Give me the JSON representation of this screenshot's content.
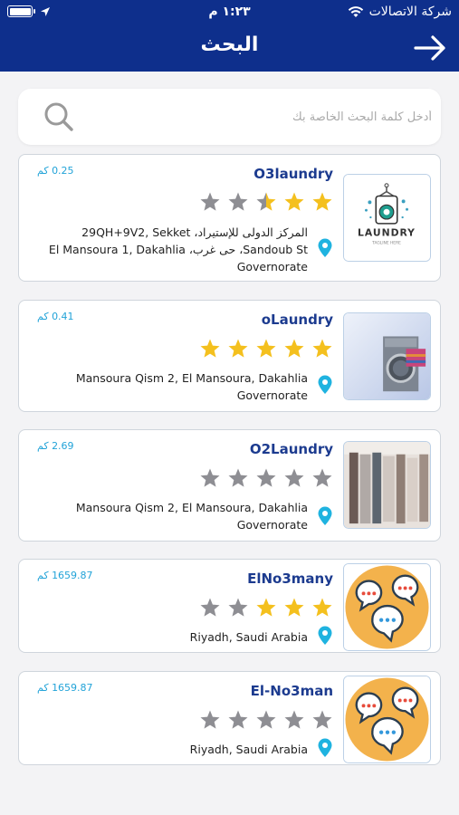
{
  "status_bar": {
    "carrier": "شركة الاتصالات",
    "time": "١:٢٣ م"
  },
  "header": {
    "title": "البحث"
  },
  "search": {
    "placeholder": "أدخل كلمة البحث الخاصة بك",
    "value": ""
  },
  "colors": {
    "header_bg": "#0e2f8c",
    "name": "#1c3b8f",
    "distance": "#22a3d8",
    "star_filled": "#f4c01e",
    "star_empty": "#8e8e93",
    "pin": "#1fb3e0"
  },
  "results": [
    {
      "name": "O3laundry",
      "distance": "0.25 كم",
      "rating": 2.5,
      "address": "المركز الدولى للإستيراد، 29QH+9V2, Sekket Sandoub St، حى غرب، El Mansoura 1, Dakahlia Governorate",
      "image": "laundry-logo"
    },
    {
      "name": "oLaundry",
      "distance": "0.41 كم",
      "rating": 5,
      "address": "Mansoura Qism 2, El Mansoura, Dakahlia Governorate",
      "image": "washing-machine-photo"
    },
    {
      "name": "O2Laundry",
      "distance": "2.69 كم",
      "rating": 0,
      "address": "Mansoura Qism 2, El Mansoura, Dakahlia Governorate",
      "image": "clothes-rack-photo"
    },
    {
      "name": "ElNo3many",
      "distance": "1659.87 كم",
      "rating": 3,
      "address": "Riyadh, Saudi Arabia",
      "image": "chat-bubbles-icon"
    },
    {
      "name": "El-No3man",
      "distance": "1659.87 كم",
      "rating": 0,
      "address": "Riyadh, Saudi Arabia",
      "image": "chat-bubbles-icon"
    }
  ]
}
